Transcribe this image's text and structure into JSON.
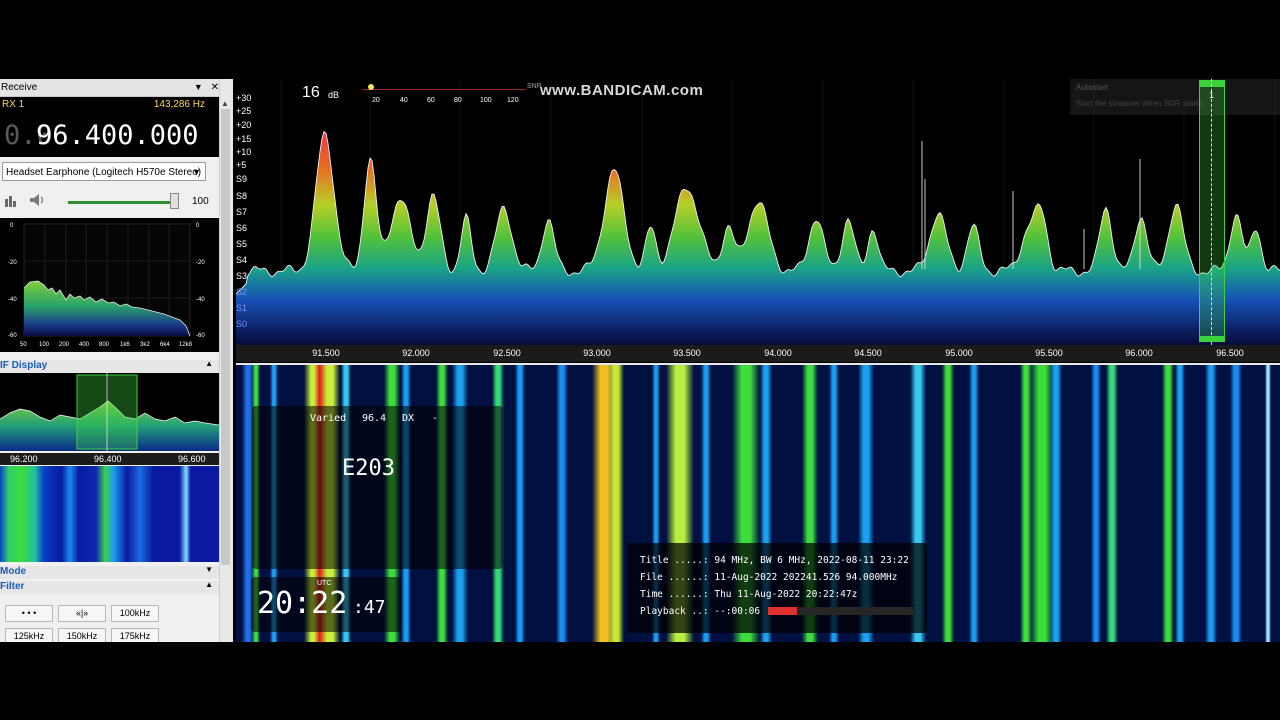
{
  "receive_panel": {
    "title": "Receive",
    "rx_label": "RX 1",
    "offset": "143,286 Hz",
    "freq_dim": "0.0",
    "freq_main": "96.400.000",
    "audio_device": "Headset Earphone (Logitech H570e Stereo)",
    "volume_value": "100",
    "volume_level_fraction": 0.97,
    "audio_spectrum_y_labels_left": [
      "0",
      "-20",
      "-40",
      "-60"
    ],
    "audio_spectrum_y_labels_right": [
      "0",
      "-20",
      "-40",
      "-60"
    ],
    "audio_spectrum_x_labels": [
      "50",
      "100",
      "200",
      "400",
      "800",
      "1k6",
      "3k2",
      "6k4",
      "12k8"
    ]
  },
  "if_display": {
    "title": "IF Display",
    "freq_labels": [
      "96.200",
      "96.400",
      "96.600"
    ]
  },
  "mode_section": {
    "title": "Mode"
  },
  "filter_section": {
    "title": "Filter",
    "buttons": [
      "• • •",
      "«|»",
      "100kHz",
      "125kHz",
      "150kHz",
      "175kHz"
    ]
  },
  "spectrum": {
    "snr_value": "16",
    "snr_unit": "dB",
    "snr_label": "SNR",
    "snr_scale": [
      "20",
      "40",
      "60",
      "80",
      "100",
      "120"
    ],
    "watermark": "www.BANDICAM.com",
    "db_labels": [
      "+30",
      "+25",
      "+20",
      "+15",
      "+10",
      "+5",
      "S9",
      "S8",
      "S7",
      "S6",
      "S5",
      "S4",
      "S3",
      "S2",
      "S1",
      "S0"
    ],
    "freq_labels": [
      "91.500",
      "92.000",
      "92.500",
      "93.000",
      "93.500",
      "94.000",
      "94.500",
      "95.000",
      "95.500",
      "96.000",
      "96.500"
    ],
    "vfo_marker": "1",
    "tooltip_title": "Autostart",
    "tooltip_text": "Start the streamer when SDR starts"
  },
  "rds_overlay": {
    "pty": "Varied",
    "freq": "96.4",
    "tag": "DX",
    "dash": "-",
    "ps": "E203"
  },
  "clock": {
    "utc_label": "UTC",
    "hm": "20:22",
    "sec": ":47"
  },
  "file_info": {
    "title_line": "Title .....: 94 MHz, BW 6 MHz, 2022-08-11 23:22",
    "file_line": "File ......: 11-Aug-2022 202241.526 94.000MHz",
    "time_line": "Time ......: Thu 11-Aug-2022 20:22:47z",
    "playback_line": "Playback ..: --:00:06",
    "playback_fraction": 0.02
  },
  "colors": {
    "accent_blue": "#1a5dbe",
    "rx_yellow": "#ffd35a",
    "vfo_green": "#3cd23c"
  }
}
